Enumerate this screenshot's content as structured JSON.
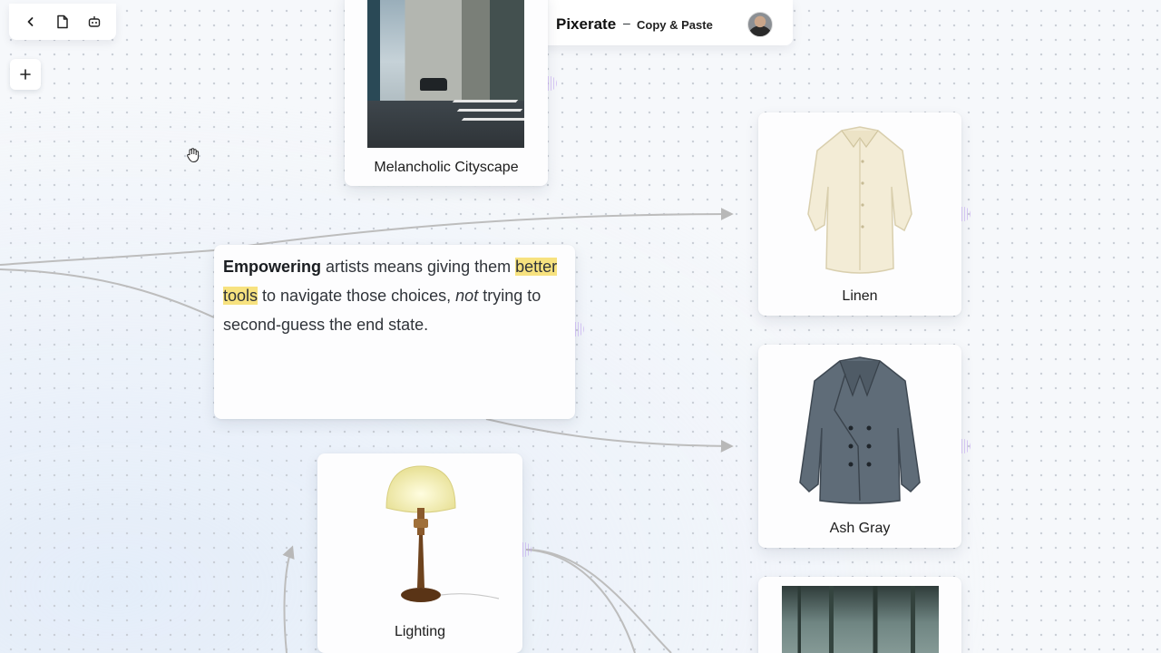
{
  "app": {
    "name": "Pixerate",
    "separator": "–",
    "subtitle": "Copy & Paste"
  },
  "toolbar": {
    "back_icon": "chevron-left-icon",
    "document_icon": "document-icon",
    "robot_icon": "robot-icon",
    "add_icon": "plus-icon",
    "add_label": "+"
  },
  "canvas": {
    "cursor_icon": "hand-grab-icon"
  },
  "text_note": {
    "bold": "Empowering",
    "part1": " artists means giving them ",
    "highlight": "better tools",
    "part2": " to navigate those choices, ",
    "italic": "not",
    "part3": " trying to second-guess the end state.",
    "highlight_color": "#f7e27f"
  },
  "nodes": [
    {
      "caption": "Melancholic Cityscape"
    },
    {
      "caption": "Linen"
    },
    {
      "caption": "Ash Gray"
    },
    {
      "caption": "Lighting"
    },
    {
      "caption": ""
    }
  ],
  "colors": {
    "edge": "#b8b8b8",
    "handle": "#c7a8f4",
    "canvas_dot": "#c9ced6"
  }
}
